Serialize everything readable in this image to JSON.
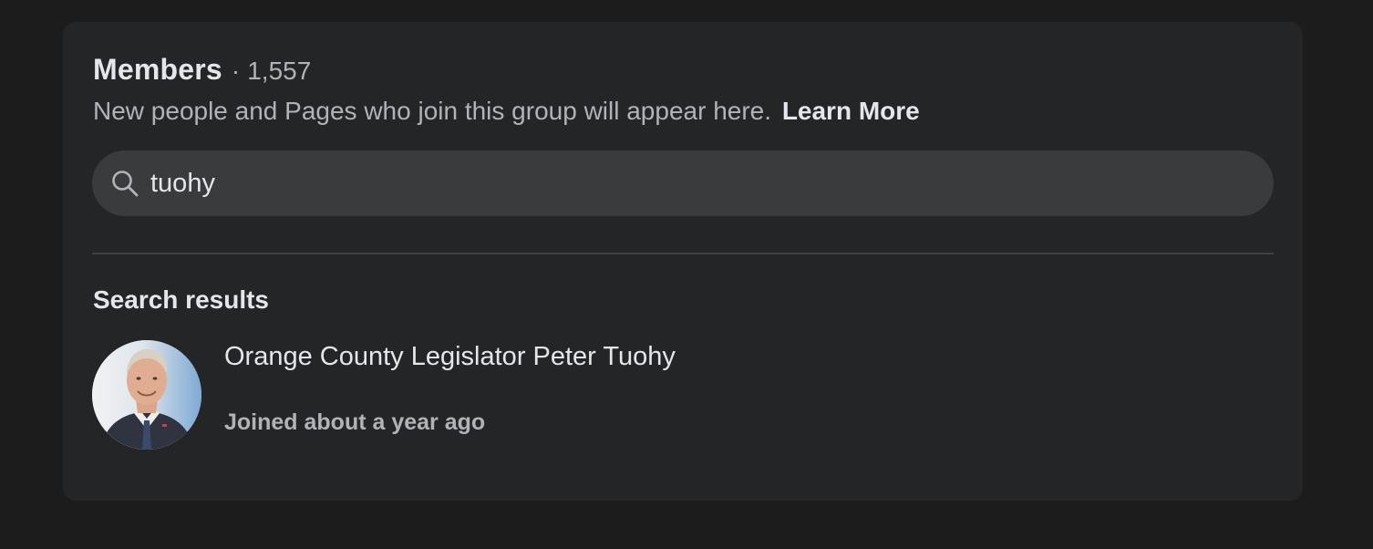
{
  "members": {
    "title": "Members",
    "separator": "·",
    "count": "1,557",
    "description": "New people and Pages who join this group will appear here.",
    "learn_more": "Learn More"
  },
  "search": {
    "value": "tuohy",
    "icon": "search-icon"
  },
  "results": {
    "heading": "Search results",
    "items": [
      {
        "name": "Orange County Legislator Peter Tuohy",
        "meta": "Joined about a year ago",
        "avatar": "profile-photo"
      }
    ]
  },
  "colors": {
    "page_background": "#1c1c1d",
    "card_background": "#242526",
    "search_background": "#3a3b3c",
    "primary_text": "#e4e6eb",
    "secondary_text": "#b0b3b8"
  }
}
